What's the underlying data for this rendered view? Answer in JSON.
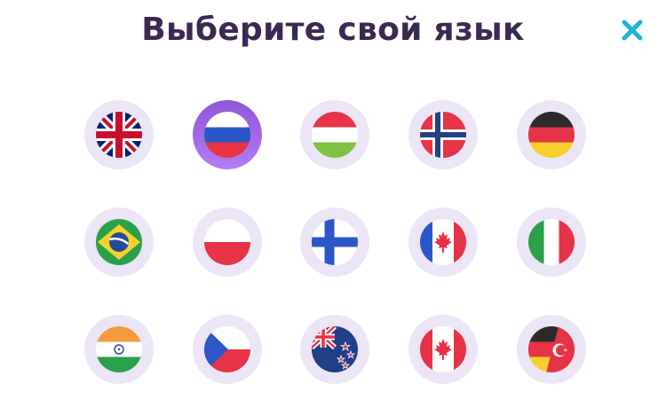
{
  "header": {
    "title": "Выберите свой язык"
  },
  "icons": {
    "close": "close-icon",
    "close_color": "#1bb5d9"
  },
  "colors": {
    "title": "#3b2952",
    "tile_bg": "#ebe5f5",
    "selected_ring": "#9a63e2"
  },
  "languages": [
    {
      "flag": "uk-flag-icon",
      "selected": false
    },
    {
      "flag": "russia-flag-icon",
      "selected": true
    },
    {
      "flag": "hungary-flag-icon",
      "selected": false
    },
    {
      "flag": "norway-flag-icon",
      "selected": false
    },
    {
      "flag": "germany-flag-icon",
      "selected": false
    },
    {
      "flag": "brazil-flag-icon",
      "selected": false
    },
    {
      "flag": "poland-flag-icon",
      "selected": false
    },
    {
      "flag": "finland-flag-icon",
      "selected": false
    },
    {
      "flag": "canada-france-flag-icon",
      "selected": false
    },
    {
      "flag": "italy-flag-icon",
      "selected": false
    },
    {
      "flag": "india-flag-icon",
      "selected": false
    },
    {
      "flag": "czech-flag-icon",
      "selected": false
    },
    {
      "flag": "new-zealand-flag-icon",
      "selected": false
    },
    {
      "flag": "canada-flag-icon",
      "selected": false
    },
    {
      "flag": "germany-turkey-flag-icon",
      "selected": false
    }
  ]
}
